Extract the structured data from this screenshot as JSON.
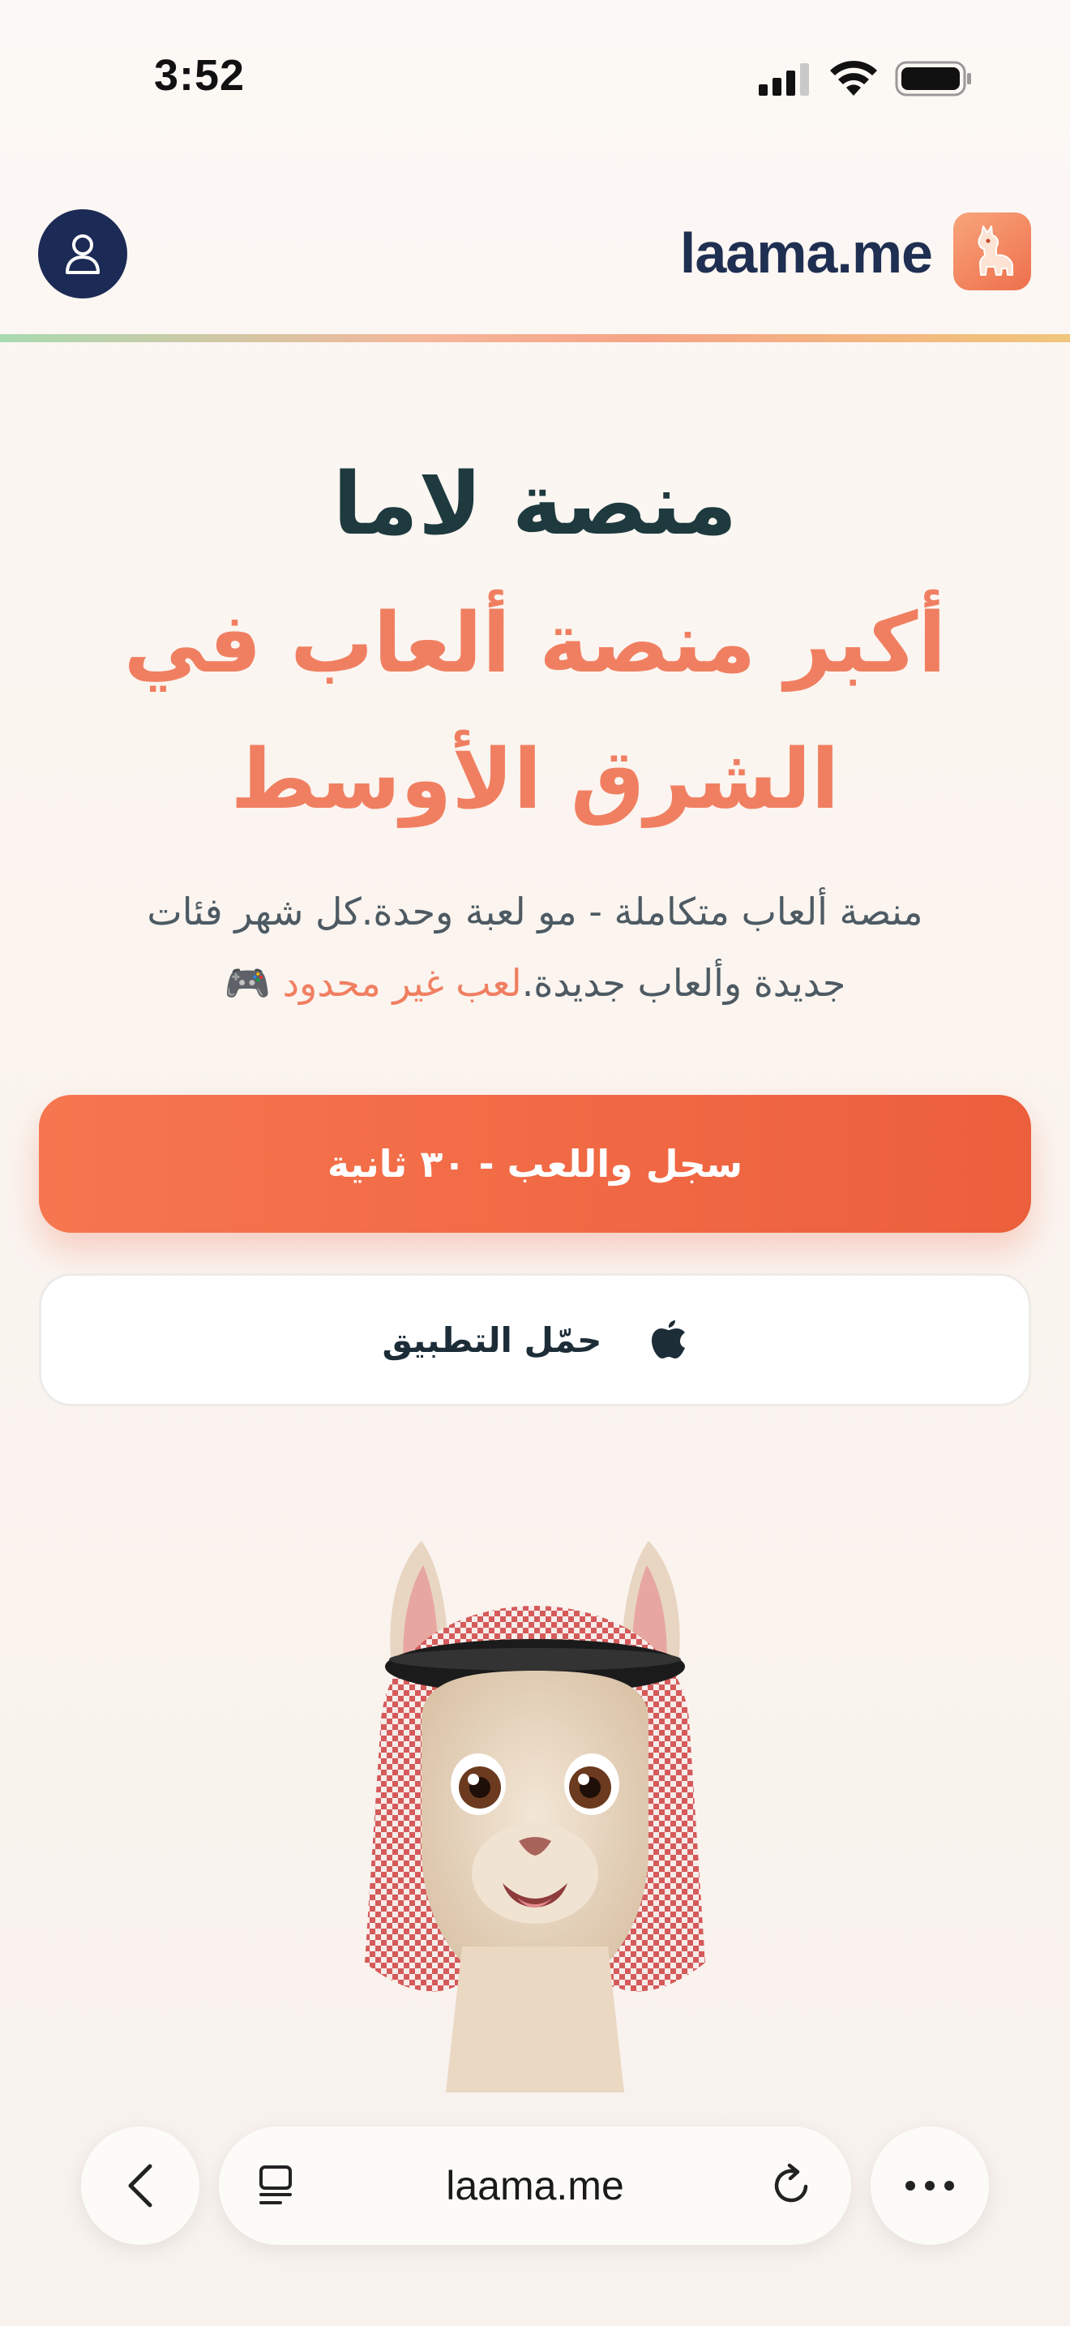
{
  "status_bar": {
    "time": "3:52"
  },
  "header": {
    "brand_name": "laama.me",
    "avatar_icon": "user-icon",
    "logo_icon": "llama-logo-icon"
  },
  "hero": {
    "title": "منصة لاما",
    "subtitle_line1": "أكبر منصة ألعاب في",
    "subtitle_line2": "الشرق الأوسط",
    "description_line1": "منصة ألعاب متكاملة - مو لعبة وحدة.كل شهر فئات",
    "description_line2_start": "جديدة وألعاب جديدة.",
    "description_accent": "لعب غير محدود",
    "description_emoji": "🎮"
  },
  "buttons": {
    "primary_label": "سجل واللعب - ٣٠ ثانية",
    "secondary_label": "حمّل التطبيق",
    "secondary_icon": "apple-icon"
  },
  "browser": {
    "url": "laama.me",
    "back_icon": "chevron-left-icon",
    "tabs_icon": "reader-icon",
    "reload_icon": "reload-icon",
    "more_icon": "more-icon"
  },
  "colors": {
    "accent": "#f07f61",
    "primary_button": "#ef6642",
    "navy": "#1f2f52",
    "title": "#1e3a3e"
  }
}
